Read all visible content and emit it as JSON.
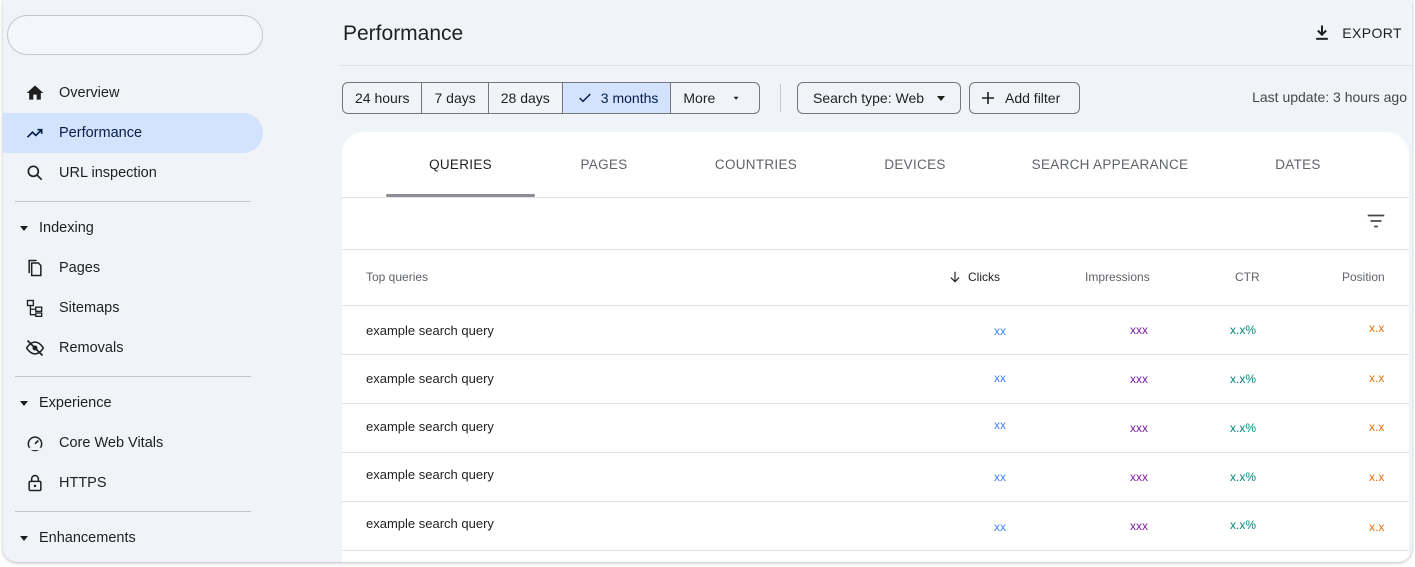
{
  "sidebar": {
    "search_placeholder": "",
    "nav": [
      {
        "label": "Overview",
        "icon": "home-icon"
      },
      {
        "label": "Performance",
        "icon": "trending-up-icon"
      },
      {
        "label": "URL inspection",
        "icon": "search-icon"
      }
    ],
    "sections": [
      {
        "label": "Indexing",
        "items": [
          {
            "label": "Pages"
          },
          {
            "label": "Sitemaps"
          },
          {
            "label": "Removals"
          }
        ]
      },
      {
        "label": "Experience",
        "items": [
          {
            "label": "Core Web Vitals"
          },
          {
            "label": "HTTPS"
          }
        ]
      },
      {
        "label": "Enhancements",
        "items": []
      }
    ]
  },
  "header": {
    "title": "Performance",
    "export_label": "EXPORT"
  },
  "toolbar": {
    "ranges": [
      "24 hours",
      "7 days",
      "28 days",
      "3 months",
      "More"
    ],
    "selected_range": "3 months",
    "search_type": "Search type: Web",
    "add_filter": "Add filter",
    "last_update": "Last update: 3 hours ago"
  },
  "tabs": [
    "QUERIES",
    "PAGES",
    "COUNTRIES",
    "DEVICES",
    "SEARCH APPEARANCE",
    "DATES"
  ],
  "active_tab": "QUERIES",
  "table": {
    "columns": [
      "Top queries",
      "Clicks",
      "Impressions",
      "CTR",
      "Position"
    ],
    "sorted_column": "Clicks",
    "rows": [
      {
        "query": "example search query",
        "clicks": "xx",
        "impressions": "xxx",
        "ctr": "x.x%",
        "position": "x.x"
      },
      {
        "query": "example search query",
        "clicks": "xx",
        "impressions": "xxx",
        "ctr": "x.x%",
        "position": "x.x"
      },
      {
        "query": "example search query",
        "clicks": "xx",
        "impressions": "xxx",
        "ctr": "x.x%",
        "position": "x.x"
      },
      {
        "query": "example search query",
        "clicks": "xx",
        "impressions": "xxx",
        "ctr": "x.x%",
        "position": "x.x"
      },
      {
        "query": "example search query",
        "clicks": "xx",
        "impressions": "xxx",
        "ctr": "x.x%",
        "position": "x.x"
      }
    ]
  },
  "colors": {
    "clicks": "#4285f4",
    "impressions": "#7b1fa2",
    "ctr": "#00897b",
    "position": "#e8710a",
    "active_bg": "#d3e3fd"
  }
}
